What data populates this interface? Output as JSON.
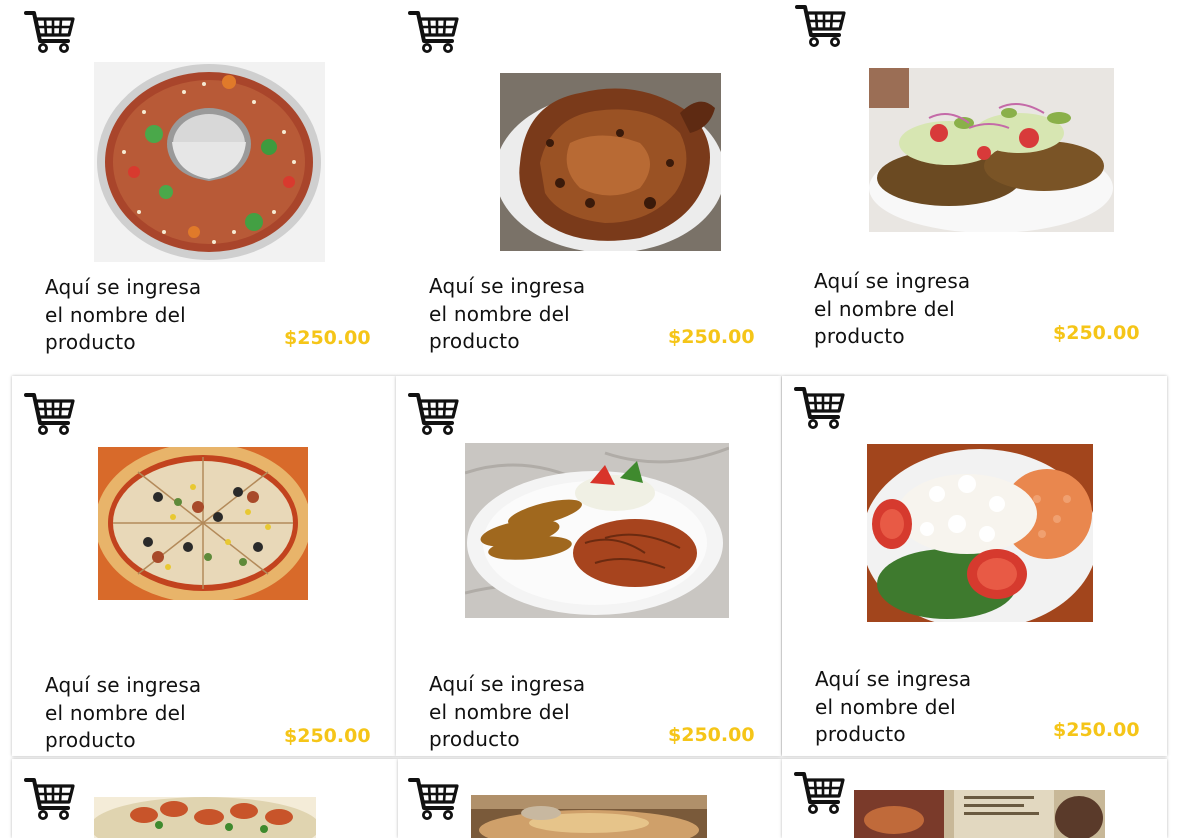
{
  "colors": {
    "price": "#f5c518",
    "text": "#111111",
    "card_border": "#dddddd"
  },
  "icons": {
    "cart": "shopping-cart-icon"
  },
  "products": [
    {
      "name_lines": [
        "Aquí se ingresa",
        "el nombre del",
        "producto"
      ],
      "price": "$250.00",
      "image": "rosca-de-reyes"
    },
    {
      "name_lines": [
        "Aquí se ingresa",
        "el nombre del",
        "producto"
      ],
      "price": "$250.00",
      "image": "pollo-rostizado"
    },
    {
      "name_lines": [
        "Aquí se ingresa",
        "el nombre del",
        "producto"
      ],
      "price": "$250.00",
      "image": "tostadas"
    },
    {
      "name_lines": [
        "Aquí se ingresa",
        "el nombre del",
        "producto"
      ],
      "price": "$250.00",
      "image": "pizza"
    },
    {
      "name_lines": [
        "Aquí se ingresa",
        "el nombre del",
        "producto"
      ],
      "price": "$250.00",
      "image": "pabellon-criollo"
    },
    {
      "name_lines": [
        "Aquí se ingresa",
        "el nombre del",
        "producto"
      ],
      "price": "$250.00",
      "image": "enchiladas-con-arroz"
    },
    {
      "image": "camarones"
    },
    {
      "image": "tacos-dorados"
    },
    {
      "image": "taqueria"
    }
  ]
}
